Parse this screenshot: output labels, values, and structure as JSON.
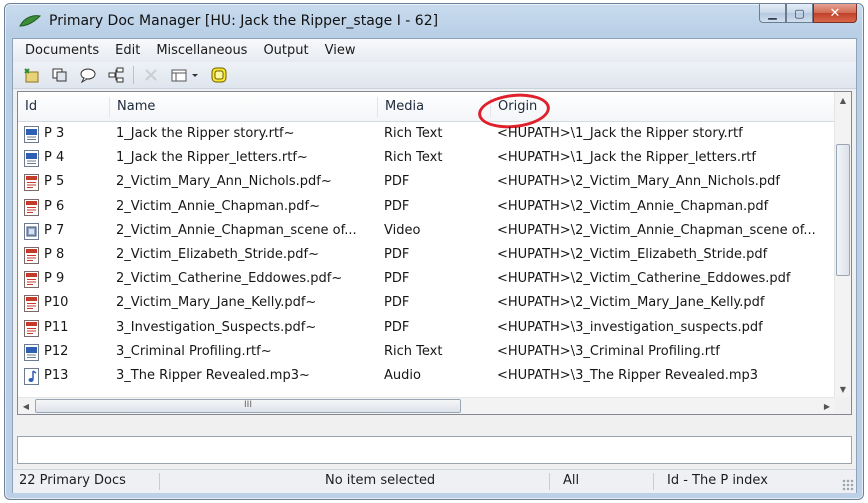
{
  "window": {
    "title": "Primary Doc Manager [HU: Jack the Ripper_stage I - 62]",
    "minimize_glyph": "▁",
    "maximize_glyph": "▢",
    "close_glyph": "✕"
  },
  "menu": [
    "Documents",
    "Edit",
    "Miscellaneous",
    "Output",
    "View"
  ],
  "toolbar": {
    "icons": [
      "new-doc-icon",
      "copy-doc-icon",
      "comment-icon",
      "tree-icon",
      "delete-icon",
      "view-options-icon",
      "highlight-icon"
    ]
  },
  "table": {
    "columns": [
      "Id",
      "Name",
      "Media",
      "Origin"
    ],
    "rows": [
      {
        "id": "P 3",
        "name": "1_Jack the Ripper story.rtf~",
        "media": "Rich Text",
        "origin": "<HUPATH>\\1_Jack the Ripper story.rtf",
        "icon": "rtf"
      },
      {
        "id": "P 4",
        "name": "1_Jack the Ripper_letters.rtf~",
        "media": "Rich Text",
        "origin": "<HUPATH>\\1_Jack the Ripper_letters.rtf",
        "icon": "rtf"
      },
      {
        "id": "P 5",
        "name": "2_Victim_Mary_Ann_Nichols.pdf~",
        "media": "PDF",
        "origin": "<HUPATH>\\2_Victim_Mary_Ann_Nichols.pdf",
        "icon": "pdf"
      },
      {
        "id": "P 6",
        "name": "2_Victim_Annie_Chapman.pdf~",
        "media": "PDF",
        "origin": "<HUPATH>\\2_Victim_Annie_Chapman.pdf",
        "icon": "pdf"
      },
      {
        "id": "P 7",
        "name": "2_Victim_Annie_Chapman_scene of...",
        "media": "Video",
        "origin": "<HUPATH>\\2_Victim_Annie_Chapman_scene of...",
        "icon": "video"
      },
      {
        "id": "P 8",
        "name": "2_Victim_Elizabeth_Stride.pdf~",
        "media": "PDF",
        "origin": "<HUPATH>\\2_Victim_Elizabeth_Stride.pdf",
        "icon": "pdf"
      },
      {
        "id": "P 9",
        "name": "2_Victim_Catherine_Eddowes.pdf~",
        "media": "PDF",
        "origin": "<HUPATH>\\2_Victim_Catherine_Eddowes.pdf",
        "icon": "pdf"
      },
      {
        "id": "P10",
        "name": "2_Victim_Mary_Jane_Kelly.pdf~",
        "media": "PDF",
        "origin": "<HUPATH>\\2_Victim_Mary_Jane_Kelly.pdf",
        "icon": "pdf"
      },
      {
        "id": "P11",
        "name": "3_Investigation_Suspects.pdf~",
        "media": "PDF",
        "origin": "<HUPATH>\\3_investigation_suspects.pdf",
        "icon": "pdf"
      },
      {
        "id": "P12",
        "name": "3_Criminal Profiling.rtf~",
        "media": "Rich Text",
        "origin": "<HUPATH>\\3_Criminal Profiling.rtf",
        "icon": "rtf"
      },
      {
        "id": "P13",
        "name": "3_The Ripper Revealed.mp3~",
        "media": "Audio",
        "origin": "<HUPATH>\\3_The Ripper Revealed.mp3",
        "icon": "audio"
      }
    ]
  },
  "scroll": {
    "up": "▲",
    "down": "▼",
    "left": "◀",
    "right": "▶",
    "grip": "III"
  },
  "status": {
    "count": "22 Primary Docs",
    "selection": "No item selected",
    "filter": "All",
    "sort": "Id - The P index"
  },
  "colors": {
    "highlight_ring": "#e0202a",
    "pdf_icon": "#c63a2a",
    "rtf_icon": "#2f5fb3"
  }
}
